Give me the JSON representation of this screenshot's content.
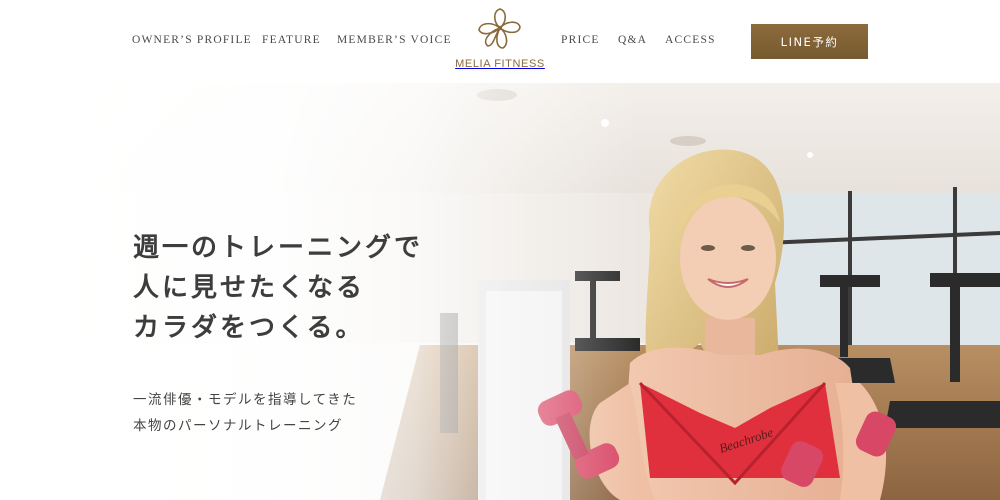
{
  "nav": {
    "left": [
      "OWNER’S PROFILE",
      "FEATURE",
      "MEMBER’S VOICE"
    ],
    "right": [
      "PRICE",
      "Q&A",
      "ACCESS"
    ]
  },
  "logo": {
    "text": "MELIA FITNESS",
    "icon": "flower-icon"
  },
  "cta": {
    "label": "LINE予約"
  },
  "hero": {
    "headline": [
      "週一のトレーニングで",
      "人に見せたくなる",
      "カラダをつくる。"
    ],
    "subcopy": [
      "一流俳優・モデルを指導してきた",
      "本物のパーソナルトレーニング"
    ],
    "shirt_text": "Beachrobe"
  },
  "colors": {
    "accent": "#7d5f33",
    "text": "#3d3d3d",
    "sports_bra": "#e0303e",
    "dumbbell": "#d94766"
  }
}
